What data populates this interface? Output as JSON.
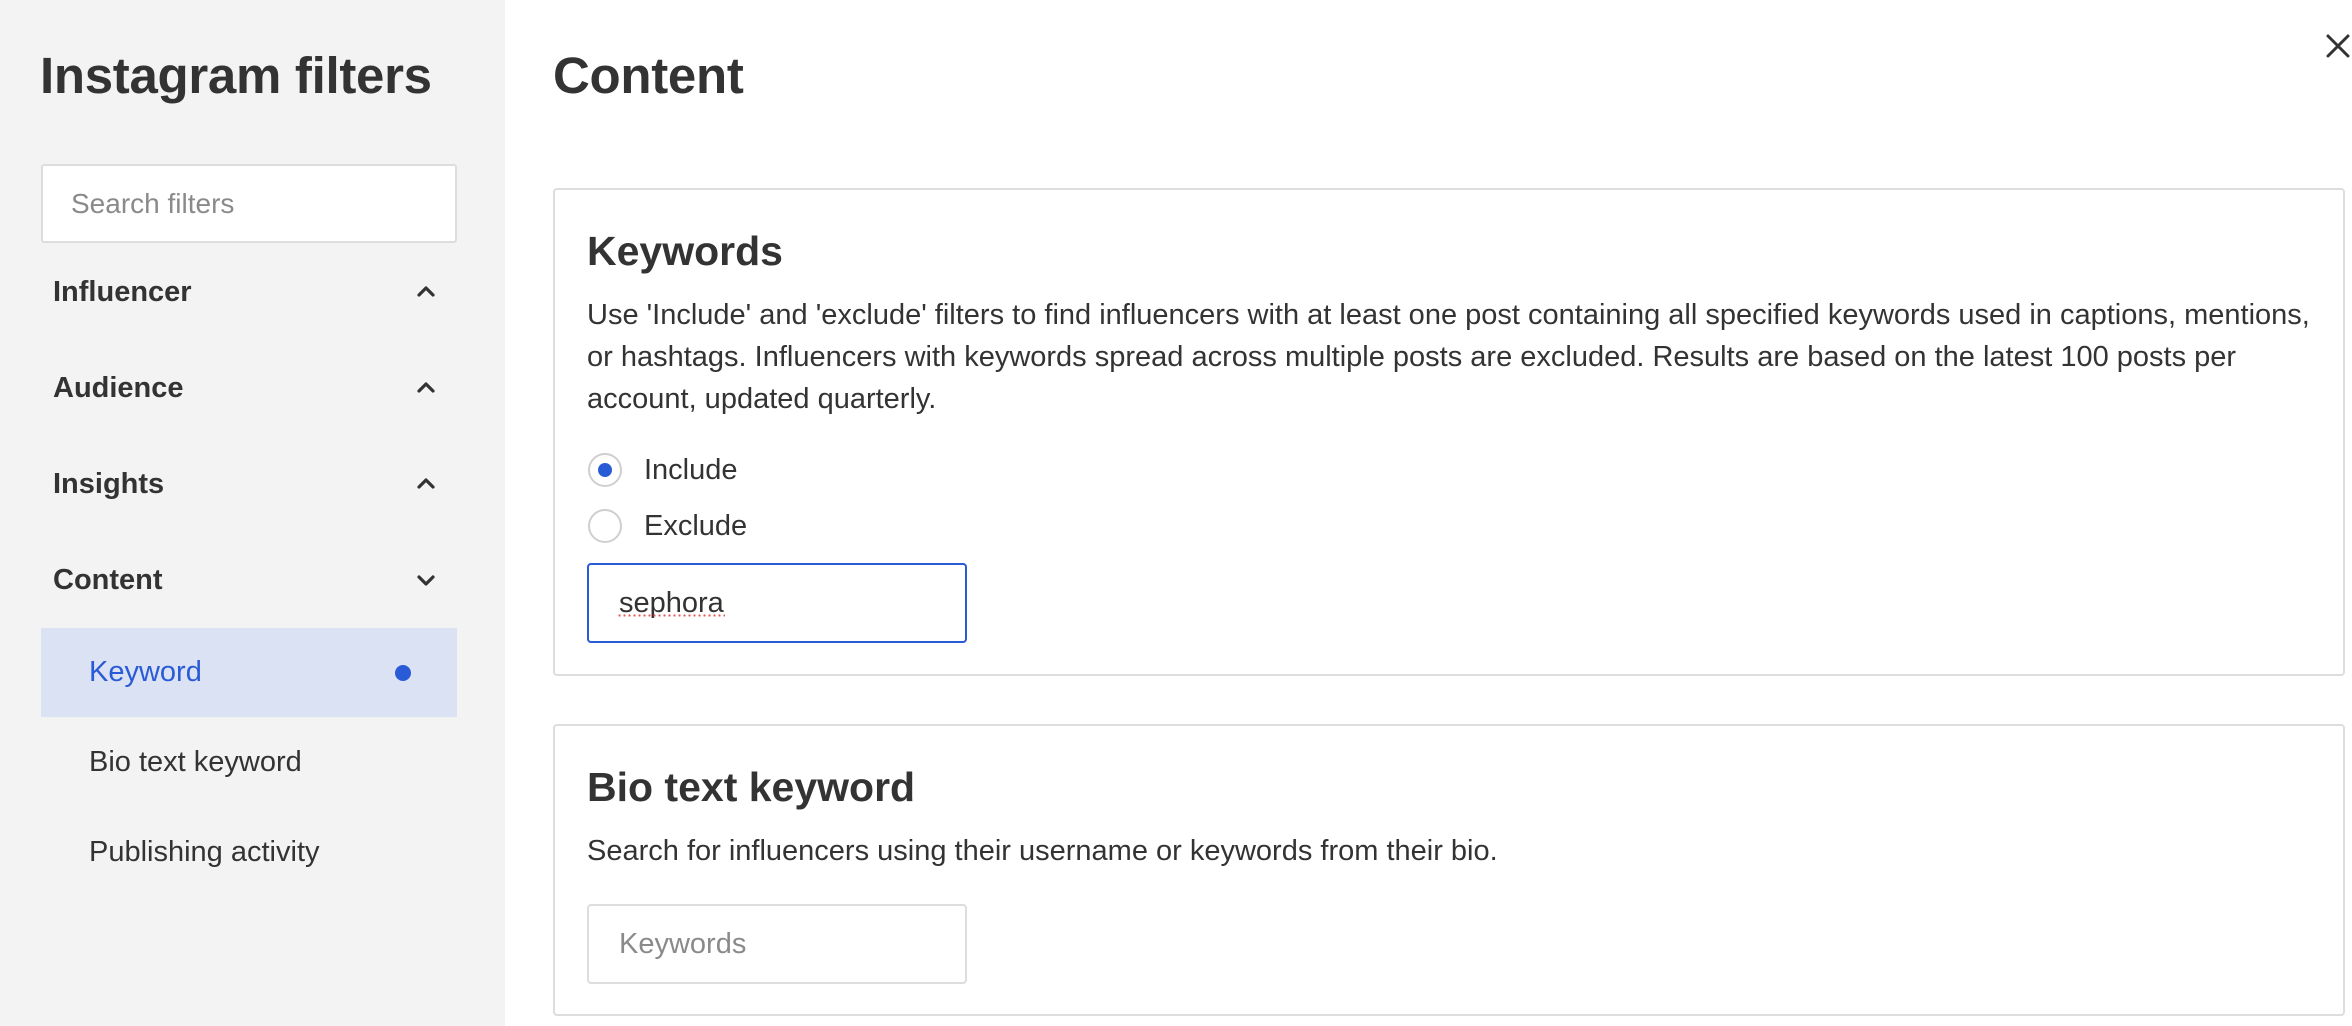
{
  "sidebar": {
    "title": "Instagram filters",
    "search_placeholder": "Search filters",
    "sections": [
      {
        "label": "Influencer",
        "expanded": false
      },
      {
        "label": "Audience",
        "expanded": false
      },
      {
        "label": "Insights",
        "expanded": false
      },
      {
        "label": "Content",
        "expanded": true
      }
    ],
    "content_items": [
      {
        "label": "Keyword",
        "active": true
      },
      {
        "label": "Bio text keyword",
        "active": false
      },
      {
        "label": "Publishing activity",
        "active": false
      }
    ]
  },
  "main": {
    "title": "Content",
    "close_icon": "close-icon",
    "keywords_card": {
      "title": "Keywords",
      "description": "Use 'Include' and 'exclude' filters to find influencers with at least one post containing all specified keywords used in captions, mentions, or hashtags. Influencers with keywords spread across multiple posts are excluded. Results are based on the latest 100 posts per account, updated quarterly.",
      "options": [
        {
          "label": "Include",
          "selected": true
        },
        {
          "label": "Exclude",
          "selected": false
        }
      ],
      "input_value": "sephora"
    },
    "bio_card": {
      "title": "Bio text keyword",
      "description": "Search for influencers using their username or keywords from their bio.",
      "input_placeholder": "Keywords"
    }
  },
  "colors": {
    "accent": "#2a5bd7",
    "active_bg": "#dbe2f3",
    "sidebar_bg": "#f3f3f3",
    "border": "#dddddd"
  }
}
